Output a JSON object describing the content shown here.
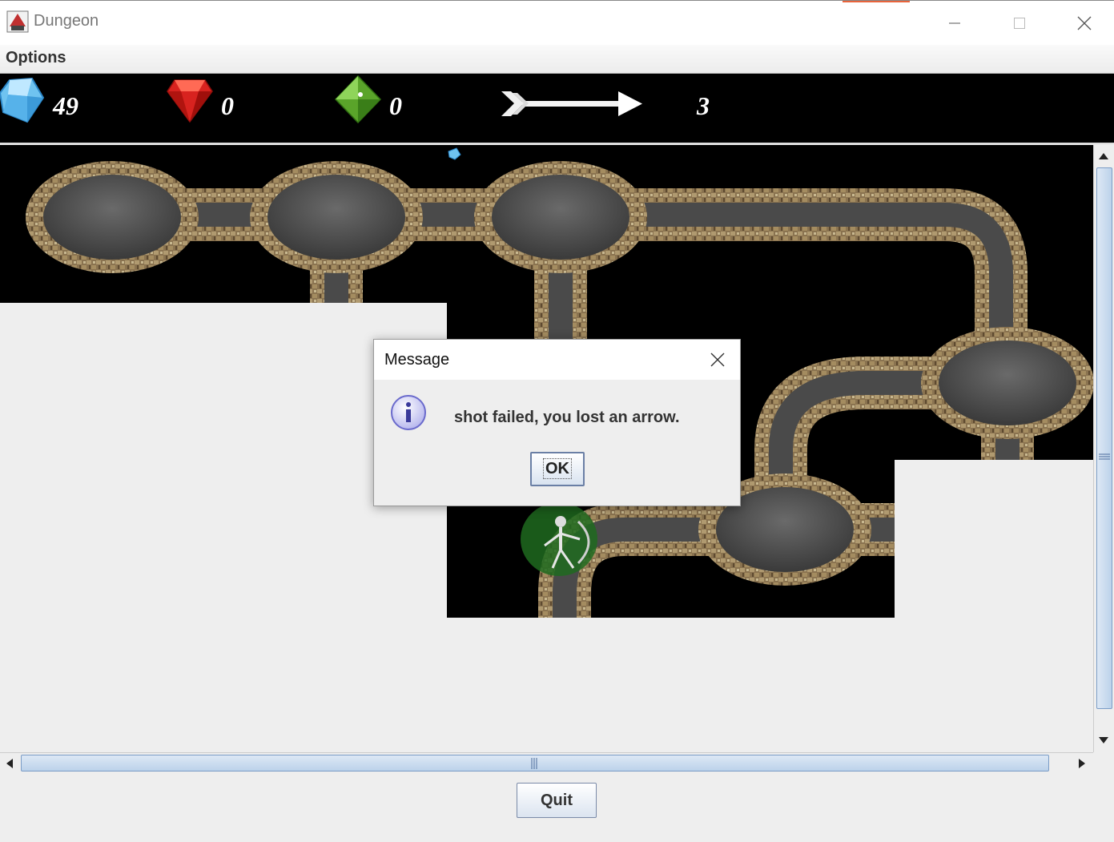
{
  "window": {
    "title": "Dungeon",
    "accent_color": "#e8643c",
    "controls": [
      "minimize-icon",
      "maximize-icon",
      "close-icon"
    ]
  },
  "menu": {
    "items": [
      {
        "label": "Options"
      }
    ]
  },
  "inventory": {
    "blue_gems": {
      "icon": "blue-gem-icon",
      "count": "49",
      "color": "#6fc3f0"
    },
    "red_gems": {
      "icon": "red-gem-icon",
      "count": "0",
      "color": "#d8231f"
    },
    "green_gems": {
      "icon": "green-gem-icon",
      "count": "0",
      "color": "#5aa42a"
    },
    "arrows": {
      "icon": "arrow-icon",
      "count": "3"
    }
  },
  "game": {
    "background": "#000000",
    "tunnel_color": "#555555",
    "wall_color": "#8a7350",
    "player_icon": "skeleton-archer-sprite"
  },
  "dialog": {
    "title": "Message",
    "icon": "info-icon",
    "message": "shot failed, you lost an arrow.",
    "ok_label": "OK"
  },
  "footer": {
    "quit_label": "Quit"
  }
}
